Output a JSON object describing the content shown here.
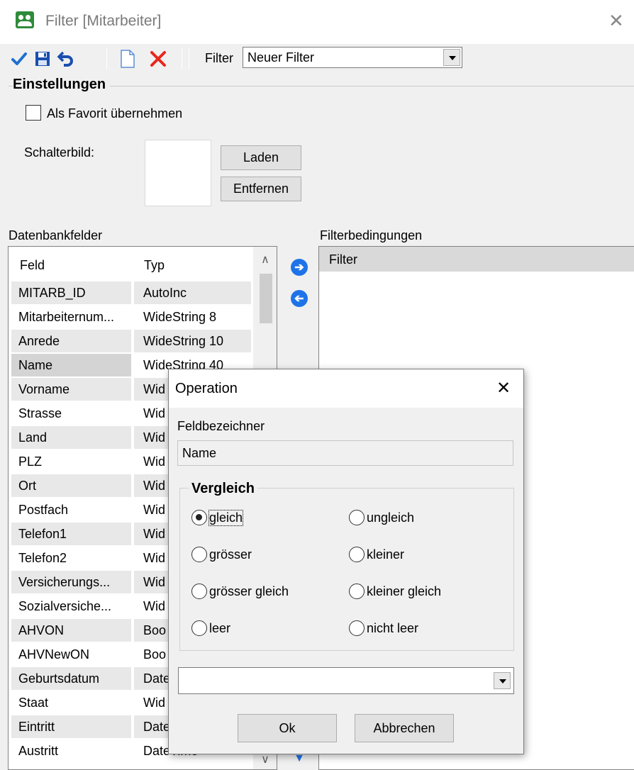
{
  "window": {
    "title": "Filter  [Mitarbeiter]"
  },
  "toolbar": {
    "buttons": [
      "check-icon",
      "save-icon",
      "undo-icon",
      "new-document-icon",
      "delete-icon"
    ],
    "filter_label": "Filter",
    "filter_value": "Neuer Filter"
  },
  "settings": {
    "title": "Einstellungen",
    "favorite_label": "Als Favorit übernehmen",
    "favorite_checked": false,
    "image_label": "Schalterbild:",
    "load_label": "Laden",
    "remove_label": "Entfernen"
  },
  "dbfields": {
    "label": "Datenbankfelder",
    "columns": [
      "Feld",
      "Typ"
    ],
    "rows": [
      {
        "feld": "MITARB_ID",
        "typ": "AutoInc"
      },
      {
        "feld": "Mitarbeiternum...",
        "typ": "WideString 8"
      },
      {
        "feld": "Anrede",
        "typ": "WideString 10"
      },
      {
        "feld": "Name",
        "typ": "WideString 40"
      },
      {
        "feld": "Vorname",
        "typ": "Wid"
      },
      {
        "feld": "Strasse",
        "typ": "Wid"
      },
      {
        "feld": "Land",
        "typ": "Wid"
      },
      {
        "feld": "PLZ",
        "typ": "Wid"
      },
      {
        "feld": "Ort",
        "typ": "Wid"
      },
      {
        "feld": "Postfach",
        "typ": "Wid"
      },
      {
        "feld": "Telefon1",
        "typ": "Wid"
      },
      {
        "feld": "Telefon2",
        "typ": "Wid"
      },
      {
        "feld": "Versicherungs...",
        "typ": "Wid"
      },
      {
        "feld": "Sozialversiche...",
        "typ": "Wid"
      },
      {
        "feld": "AHVON",
        "typ": "Boo"
      },
      {
        "feld": "AHVNewON",
        "typ": "Boo"
      },
      {
        "feld": "Geburtsdatum",
        "typ": "Date"
      },
      {
        "feld": "Staat",
        "typ": "Wid"
      },
      {
        "feld": "Eintritt",
        "typ": "Date"
      },
      {
        "feld": "Austritt",
        "typ": "DateTime"
      }
    ]
  },
  "filter_conditions": {
    "label": "Filterbedingungen",
    "root": "Filter"
  },
  "dialog": {
    "title": "Operation",
    "field_label": "Feldbezeichner",
    "field_value": "Name",
    "compare_title": "Vergleich",
    "options": [
      {
        "label": "gleich",
        "selected": true
      },
      {
        "label": "ungleich",
        "selected": false
      },
      {
        "label": "grösser",
        "selected": false
      },
      {
        "label": "kleiner",
        "selected": false
      },
      {
        "label": "grösser gleich",
        "selected": false
      },
      {
        "label": "kleiner gleich",
        "selected": false
      },
      {
        "label": "leer",
        "selected": false
      },
      {
        "label": "nicht leer",
        "selected": false
      }
    ],
    "value": "",
    "ok_label": "Ok",
    "cancel_label": "Abbrechen"
  },
  "colors": {
    "accent": "#1e73e8",
    "delete": "#e8261c",
    "save": "#1a4fb0",
    "check": "#1e6fd0"
  }
}
